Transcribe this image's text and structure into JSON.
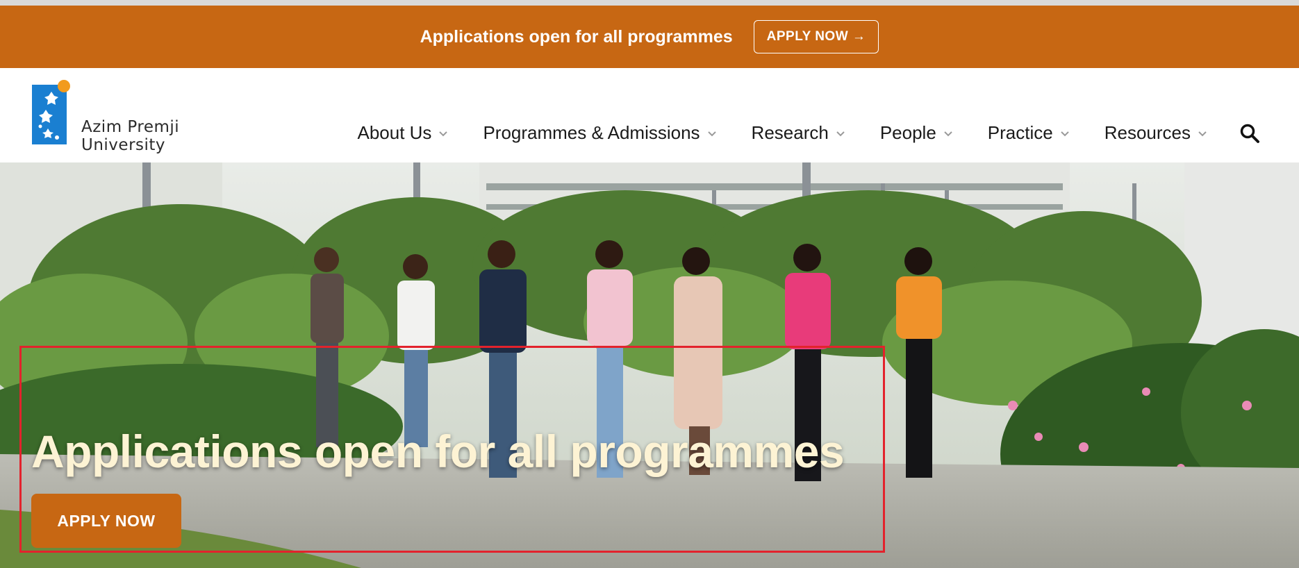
{
  "announcement": {
    "text": "Applications open for all programmes",
    "button_label": "APPLY NOW →"
  },
  "brand": {
    "line1": "Azim Premji",
    "line2": "University",
    "icon": "university-logo-icon",
    "colors": {
      "blue": "#1a7fd1",
      "orange": "#f29b1d"
    }
  },
  "nav": {
    "items": [
      {
        "label": "About Us",
        "icon": "chevron-down-icon"
      },
      {
        "label": "Programmes & Admissions",
        "icon": "chevron-down-icon"
      },
      {
        "label": "Research",
        "icon": "chevron-down-icon"
      },
      {
        "label": "People",
        "icon": "chevron-down-icon"
      },
      {
        "label": "Practice",
        "icon": "chevron-down-icon"
      },
      {
        "label": "Resources",
        "icon": "chevron-down-icon"
      }
    ],
    "search_icon": "search-icon"
  },
  "hero": {
    "title": "Applications open for all programmes",
    "button_label": "APPLY NOW",
    "image": "students-walking-campus-photo"
  },
  "colors": {
    "accent": "#c76713",
    "hero_title": "#fdf3d4",
    "highlight_box": "#e3222c"
  }
}
